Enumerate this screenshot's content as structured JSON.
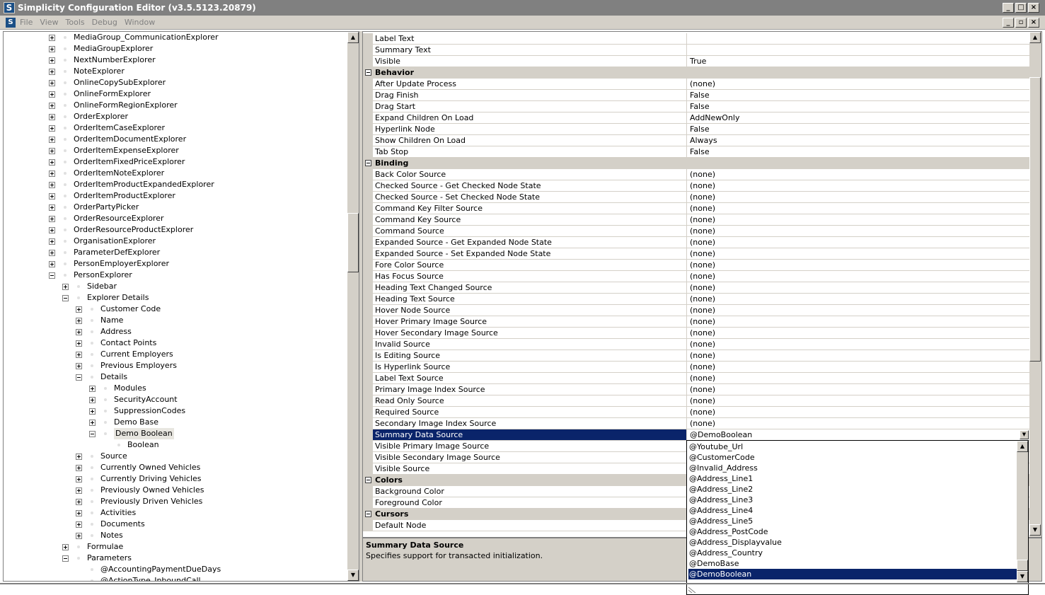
{
  "window": {
    "title": "Simplicity Configuration Editor (v3.5.5123.20879)",
    "app_icon": "S"
  },
  "menu": {
    "items": [
      "File",
      "View",
      "Tools",
      "Debug",
      "Window"
    ]
  },
  "tree": {
    "rows": [
      {
        "level": 0,
        "exp": "plus",
        "label": "MediaGroup_CommunicationExplorer"
      },
      {
        "level": 0,
        "exp": "plus",
        "label": "MediaGroupExplorer"
      },
      {
        "level": 0,
        "exp": "plus",
        "label": "NextNumberExplorer"
      },
      {
        "level": 0,
        "exp": "plus",
        "label": "NoteExplorer"
      },
      {
        "level": 0,
        "exp": "plus",
        "label": "OnlineCopySubExplorer"
      },
      {
        "level": 0,
        "exp": "plus",
        "label": "OnlineFormExplorer"
      },
      {
        "level": 0,
        "exp": "plus",
        "label": "OnlineFormRegionExplorer"
      },
      {
        "level": 0,
        "exp": "plus",
        "label": "OrderExplorer"
      },
      {
        "level": 0,
        "exp": "plus",
        "label": "OrderItemCaseExplorer"
      },
      {
        "level": 0,
        "exp": "plus",
        "label": "OrderItemDocumentExplorer"
      },
      {
        "level": 0,
        "exp": "plus",
        "label": "OrderItemExpenseExplorer"
      },
      {
        "level": 0,
        "exp": "plus",
        "label": "OrderItemFixedPriceExplorer"
      },
      {
        "level": 0,
        "exp": "plus",
        "label": "OrderItemNoteExplorer"
      },
      {
        "level": 0,
        "exp": "plus",
        "label": "OrderItemProductExpandedExplorer"
      },
      {
        "level": 0,
        "exp": "plus",
        "label": "OrderItemProductExplorer"
      },
      {
        "level": 0,
        "exp": "plus",
        "label": "OrderPartyPicker"
      },
      {
        "level": 0,
        "exp": "plus",
        "label": "OrderResourceExplorer"
      },
      {
        "level": 0,
        "exp": "plus",
        "label": "OrderResourceProductExplorer"
      },
      {
        "level": 0,
        "exp": "plus",
        "label": "OrganisationExplorer"
      },
      {
        "level": 0,
        "exp": "plus",
        "label": "ParameterDefExplorer"
      },
      {
        "level": 0,
        "exp": "plus",
        "label": "PersonEmployerExplorer"
      },
      {
        "level": 0,
        "exp": "minus",
        "label": "PersonExplorer"
      },
      {
        "level": 1,
        "exp": "plus",
        "label": "Sidebar"
      },
      {
        "level": 1,
        "exp": "minus",
        "label": "Explorer Details"
      },
      {
        "level": 2,
        "exp": "plus",
        "label": "Customer Code"
      },
      {
        "level": 2,
        "exp": "plus",
        "label": "Name"
      },
      {
        "level": 2,
        "exp": "plus",
        "label": "Address"
      },
      {
        "level": 2,
        "exp": "plus",
        "label": "Contact Points"
      },
      {
        "level": 2,
        "exp": "plus",
        "label": "Current Employers"
      },
      {
        "level": 2,
        "exp": "plus",
        "label": "Previous Employers"
      },
      {
        "level": 2,
        "exp": "minus",
        "label": "Details"
      },
      {
        "level": 3,
        "exp": "plus",
        "label": "Modules"
      },
      {
        "level": 3,
        "exp": "plus",
        "label": "SecurityAccount"
      },
      {
        "level": 3,
        "exp": "plus",
        "label": "SuppressionCodes"
      },
      {
        "level": 3,
        "exp": "plus",
        "label": "Demo Base"
      },
      {
        "level": 3,
        "exp": "minus",
        "label": "Demo Boolean",
        "selected": true
      },
      {
        "level": 4,
        "exp": "none",
        "label": "Boolean"
      },
      {
        "level": 2,
        "exp": "plus",
        "label": "Source"
      },
      {
        "level": 2,
        "exp": "plus",
        "label": "Currently Owned Vehicles"
      },
      {
        "level": 2,
        "exp": "plus",
        "label": "Currently Driving Vehicles"
      },
      {
        "level": 2,
        "exp": "plus",
        "label": "Previously Owned Vehicles"
      },
      {
        "level": 2,
        "exp": "plus",
        "label": "Previously Driven Vehicles"
      },
      {
        "level": 2,
        "exp": "plus",
        "label": "Activities"
      },
      {
        "level": 2,
        "exp": "plus",
        "label": "Documents"
      },
      {
        "level": 2,
        "exp": "plus",
        "label": "Notes"
      },
      {
        "level": 1,
        "exp": "plus",
        "label": "Formulae"
      },
      {
        "level": 1,
        "exp": "minus",
        "label": "Parameters"
      },
      {
        "level": 2,
        "exp": "none",
        "label": "@AccountingPaymentDueDays"
      },
      {
        "level": 2,
        "exp": "none",
        "label": "@ActionType_InboundCall"
      }
    ]
  },
  "grid": {
    "rows": [
      {
        "type": "prop",
        "name": "Label Text",
        "value": ""
      },
      {
        "type": "prop",
        "name": "Summary Text",
        "value": ""
      },
      {
        "type": "prop",
        "name": "Visible",
        "value": "True"
      },
      {
        "type": "cat",
        "name": "Behavior"
      },
      {
        "type": "prop",
        "name": "After Update Process",
        "value": "(none)"
      },
      {
        "type": "prop",
        "name": "Drag Finish",
        "value": "False"
      },
      {
        "type": "prop",
        "name": "Drag Start",
        "value": "False"
      },
      {
        "type": "prop",
        "name": "Expand Children On Load",
        "value": "AddNewOnly"
      },
      {
        "type": "prop",
        "name": "Hyperlink Node",
        "value": "False"
      },
      {
        "type": "prop",
        "name": "Show Children On Load",
        "value": "Always"
      },
      {
        "type": "prop",
        "name": "Tab Stop",
        "value": "False"
      },
      {
        "type": "cat",
        "name": "Binding"
      },
      {
        "type": "prop",
        "name": "Back Color Source",
        "value": "(none)"
      },
      {
        "type": "prop",
        "name": "Checked Source - Get Checked Node State",
        "value": "(none)"
      },
      {
        "type": "prop",
        "name": "Checked Source - Set Checked Node State",
        "value": "(none)"
      },
      {
        "type": "prop",
        "name": "Command Key Filter Source",
        "value": "(none)"
      },
      {
        "type": "prop",
        "name": "Command Key Source",
        "value": "(none)"
      },
      {
        "type": "prop",
        "name": "Command Source",
        "value": "(none)"
      },
      {
        "type": "prop",
        "name": "Expanded Source - Get Expanded Node State",
        "value": "(none)"
      },
      {
        "type": "prop",
        "name": "Expanded Source - Set Expanded Node State",
        "value": "(none)"
      },
      {
        "type": "prop",
        "name": "Fore Color Source",
        "value": "(none)"
      },
      {
        "type": "prop",
        "name": "Has Focus Source",
        "value": "(none)"
      },
      {
        "type": "prop",
        "name": "Heading Text Changed Source",
        "value": "(none)"
      },
      {
        "type": "prop",
        "name": "Heading Text Source",
        "value": "(none)"
      },
      {
        "type": "prop",
        "name": "Hover Node Source",
        "value": "(none)"
      },
      {
        "type": "prop",
        "name": "Hover Primary Image Source",
        "value": "(none)"
      },
      {
        "type": "prop",
        "name": "Hover Secondary Image Source",
        "value": "(none)"
      },
      {
        "type": "prop",
        "name": "Invalid Source",
        "value": "(none)"
      },
      {
        "type": "prop",
        "name": "Is Editing Source",
        "value": "(none)"
      },
      {
        "type": "prop",
        "name": "Is Hyperlink Source",
        "value": "(none)"
      },
      {
        "type": "prop",
        "name": "Label Text Source",
        "value": "(none)"
      },
      {
        "type": "prop",
        "name": "Primary Image Index Source",
        "value": "(none)"
      },
      {
        "type": "prop",
        "name": "Read Only Source",
        "value": "(none)"
      },
      {
        "type": "prop",
        "name": "Required Source",
        "value": "(none)"
      },
      {
        "type": "prop",
        "name": "Secondary Image Index Source",
        "value": "(none)"
      },
      {
        "type": "prop",
        "name": "Summary Data Source",
        "value": "@DemoBoolean",
        "selected": true
      },
      {
        "type": "prop",
        "name": "Visible Primary Image Source",
        "value": ""
      },
      {
        "type": "prop",
        "name": "Visible Secondary Image Source",
        "value": ""
      },
      {
        "type": "prop",
        "name": "Visible Source",
        "value": ""
      },
      {
        "type": "cat",
        "name": "Colors"
      },
      {
        "type": "prop",
        "name": "Background Color",
        "value": ""
      },
      {
        "type": "prop",
        "name": "Foreground Color",
        "value": ""
      },
      {
        "type": "cat",
        "name": "Cursors"
      },
      {
        "type": "prop",
        "name": "Default Node",
        "value": ""
      }
    ]
  },
  "description": {
    "title": "Summary Data Source",
    "text": "Specifies support for transacted initialization."
  },
  "dropdown": {
    "items": [
      "@Youtube_Url",
      "@CustomerCode",
      "@Invalid_Address",
      "@Address_Line1",
      "@Address_Line2",
      "@Address_Line3",
      "@Address_Line4",
      "@Address_Line5",
      "@Address_PostCode",
      "@Address_Displayvalue",
      "@Address_Country",
      "@DemoBase",
      "@DemoBoolean"
    ],
    "selected": "@DemoBoolean"
  },
  "colors": {
    "selection": "#0a246a",
    "face": "#d4d0c8",
    "title_bar": "#808080"
  }
}
